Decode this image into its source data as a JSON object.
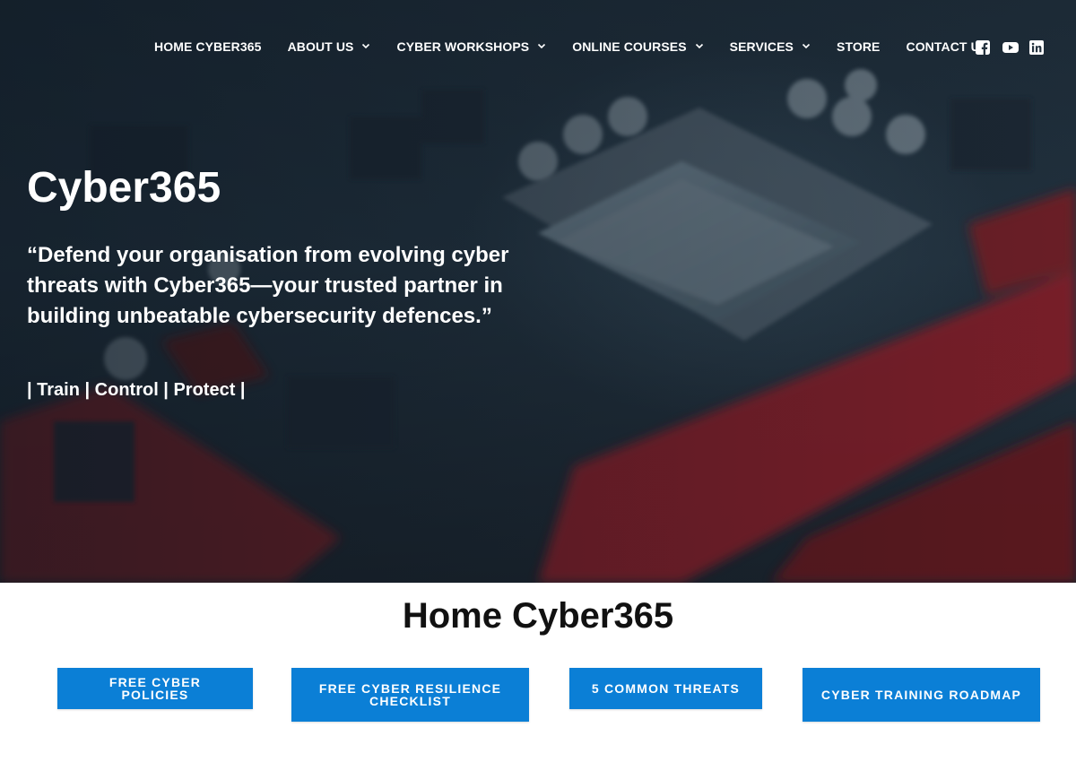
{
  "nav": {
    "items": [
      {
        "label": "HOME CYBER365",
        "dropdown": false
      },
      {
        "label": "ABOUT US",
        "dropdown": true
      },
      {
        "label": "CYBER WORKSHOPS",
        "dropdown": true
      },
      {
        "label": "ONLINE COURSES",
        "dropdown": true
      },
      {
        "label": "SERVICES",
        "dropdown": true
      },
      {
        "label": "STORE",
        "dropdown": false
      },
      {
        "label": "CONTACT US",
        "dropdown": false
      }
    ],
    "socials": [
      "facebook-icon",
      "youtube-icon",
      "linkedin-icon"
    ]
  },
  "hero": {
    "title": "Cyber365",
    "quote": "“Defend your organisation from evolving cyber threats with Cyber365—your trusted partner in building unbeatable cybersecurity defences.”",
    "tagline": "| Train | Control | Protect |"
  },
  "main": {
    "heading": "Home Cyber365",
    "buttons": [
      {
        "label": "FREE CYBER POLICIES"
      },
      {
        "label": "FREE CYBER RESILIENCE CHECKLIST"
      },
      {
        "label": "5 COMMON THREATS"
      },
      {
        "label": "CYBER TRAINING ROADMAP"
      }
    ]
  },
  "colors": {
    "accent": "#0b7fd6",
    "nav_text": "#ffffff",
    "heading": "#111111"
  }
}
